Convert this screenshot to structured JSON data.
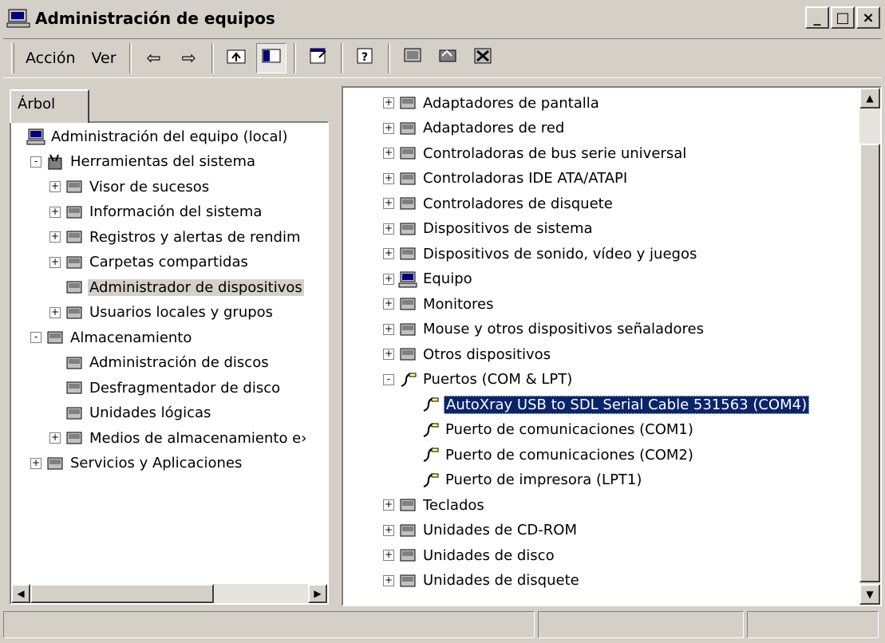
{
  "window": {
    "title": "Administración de equipos",
    "buttons": {
      "minimize": "_",
      "maximize": "□",
      "close": "×"
    }
  },
  "menu": {
    "accion": "Acción",
    "ver": "Ver"
  },
  "toolbar_icons": [
    "back-arrow-icon",
    "forward-arrow-icon",
    "up-folder-icon",
    "show-hide-tree-icon",
    "properties-icon",
    "help-icon",
    "scan-hardware-icon",
    "update-driver-icon",
    "uninstall-device-icon"
  ],
  "left": {
    "tab": "Árbol",
    "items": [
      {
        "label": "Administración del equipo (local)",
        "icon": "computer-icon",
        "level": 0,
        "exp": ""
      },
      {
        "label": "Herramientas del sistema",
        "icon": "tools-icon",
        "level": 1,
        "exp": "-"
      },
      {
        "label": "Visor de sucesos",
        "icon": "event-viewer-icon",
        "level": 2,
        "exp": "+"
      },
      {
        "label": "Información del sistema",
        "icon": "system-info-icon",
        "level": 2,
        "exp": "+"
      },
      {
        "label": "Registros y alertas de rendim",
        "icon": "perf-logs-icon",
        "level": 2,
        "exp": "+"
      },
      {
        "label": "Carpetas compartidas",
        "icon": "shared-folder-icon",
        "level": 2,
        "exp": "+"
      },
      {
        "label": "Administrador de dispositivos",
        "icon": "device-manager-icon",
        "level": 2,
        "exp": "",
        "selected": true
      },
      {
        "label": "Usuarios locales y grupos",
        "icon": "users-icon",
        "level": 2,
        "exp": "+"
      },
      {
        "label": "Almacenamiento",
        "icon": "storage-icon",
        "level": 1,
        "exp": "-"
      },
      {
        "label": "Administración de discos",
        "icon": "disk-mgmt-icon",
        "level": 2,
        "exp": ""
      },
      {
        "label": "Desfragmentador de disco",
        "icon": "defrag-icon",
        "level": 2,
        "exp": ""
      },
      {
        "label": "Unidades lógicas",
        "icon": "logical-drive-icon",
        "level": 2,
        "exp": ""
      },
      {
        "label": "Medios de almacenamiento e›",
        "icon": "removable-storage-icon",
        "level": 2,
        "exp": "+"
      },
      {
        "label": "Servicios y Aplicaciones",
        "icon": "services-icon",
        "level": 1,
        "exp": "+"
      }
    ]
  },
  "right": {
    "items": [
      {
        "label": "Adaptadores de pantalla",
        "icon": "display-adapter-icon",
        "level": 1,
        "exp": "+"
      },
      {
        "label": "Adaptadores de red",
        "icon": "network-adapter-icon",
        "level": 1,
        "exp": "+"
      },
      {
        "label": "Controladoras de bus serie universal",
        "icon": "usb-icon",
        "level": 1,
        "exp": "+"
      },
      {
        "label": "Controladoras IDE ATA/ATAPI",
        "icon": "ide-controller-icon",
        "level": 1,
        "exp": "+"
      },
      {
        "label": "Controladores de disquete",
        "icon": "floppy-controller-icon",
        "level": 1,
        "exp": "+"
      },
      {
        "label": "Dispositivos de sistema",
        "icon": "system-device-icon",
        "level": 1,
        "exp": "+"
      },
      {
        "label": "Dispositivos de sonido, vídeo y juegos",
        "icon": "sound-icon",
        "level": 1,
        "exp": "+"
      },
      {
        "label": "Equipo",
        "icon": "computer-icon",
        "level": 1,
        "exp": "+"
      },
      {
        "label": "Monitores",
        "icon": "monitor-icon",
        "level": 1,
        "exp": "+"
      },
      {
        "label": "Mouse y otros dispositivos señaladores",
        "icon": "mouse-icon",
        "level": 1,
        "exp": "+"
      },
      {
        "label": "Otros dispositivos",
        "icon": "unknown-device-icon",
        "level": 1,
        "exp": "+"
      },
      {
        "label": "Puertos (COM & LPT)",
        "icon": "port-icon",
        "level": 1,
        "exp": "-"
      },
      {
        "label": "AutoXray USB to SDL Serial Cable 531563 (COM4)",
        "icon": "port-icon",
        "level": 2,
        "exp": "",
        "selected": true
      },
      {
        "label": "Puerto de comunicaciones (COM1)",
        "icon": "port-icon",
        "level": 2,
        "exp": ""
      },
      {
        "label": "Puerto de comunicaciones (COM2)",
        "icon": "port-icon",
        "level": 2,
        "exp": ""
      },
      {
        "label": "Puerto de impresora (LPT1)",
        "icon": "port-icon",
        "level": 2,
        "exp": ""
      },
      {
        "label": "Teclados",
        "icon": "keyboard-icon",
        "level": 1,
        "exp": "+"
      },
      {
        "label": "Unidades de CD-ROM",
        "icon": "cdrom-icon",
        "level": 1,
        "exp": "+"
      },
      {
        "label": "Unidades de disco",
        "icon": "disk-drive-icon",
        "level": 1,
        "exp": "+"
      },
      {
        "label": "Unidades de disquete",
        "icon": "floppy-drive-icon",
        "level": 1,
        "exp": "+"
      }
    ]
  },
  "status": {
    "panel1": "",
    "panel2": "",
    "panel3": ""
  }
}
